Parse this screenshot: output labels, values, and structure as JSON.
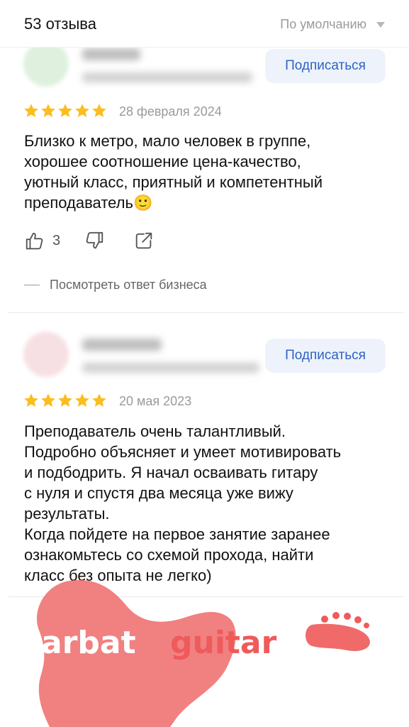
{
  "header": {
    "count_label": "53 отзыва",
    "sort_label": "По умолчанию"
  },
  "reviews": [
    {
      "subscribe_label": "Подписаться",
      "rating": 5,
      "date": "28 февраля 2024",
      "text": "Близко к метро, мало человек в группе,\nхорошее соотношение цена-качество,\nуютный класс, приятный и компетентный\nпреподаватель🙂",
      "likes": "3",
      "business_reply_label": "Посмотреть ответ бизнеса"
    },
    {
      "subscribe_label": "Подписаться",
      "rating": 5,
      "date": "20 мая 2023",
      "text": "Преподаватель очень талантливый.\nПодробно объясняет и умеет мотивировать\nи подбодрить. Я начал осваивать гитару\nс нуля и спустя два месяца уже вижу\nрезультаты.\nКогда пойдете на первое занятие заранее\nознакомьтесь со схемой прохода, найти\nкласс без опыта не легко)"
    }
  ],
  "watermark": {
    "word1": "arbat",
    "word2": "guitar"
  },
  "colors": {
    "accent": "#2e63c4",
    "star": "#fbbd1f",
    "watermark": "#ef5a5a"
  }
}
